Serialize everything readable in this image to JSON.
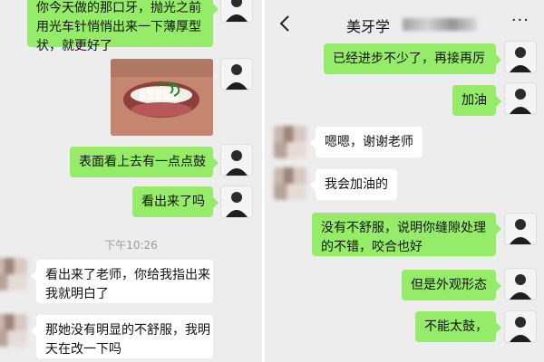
{
  "left": {
    "messages": [
      {
        "side": "me",
        "text_lines": [
          "你今天做的那口牙，抛光之前",
          "用光车针悄悄出来一下薄厚型",
          "状，就更好了"
        ]
      },
      {
        "side": "me",
        "type": "photo"
      },
      {
        "side": "me",
        "text_lines": [
          "表面看上去有一点点鼓"
        ]
      },
      {
        "side": "me",
        "text_lines": [
          "看出来了吗"
        ]
      },
      {
        "side": "other",
        "text_lines": [
          "看出来了老师，你给我指出来",
          "我就明白了"
        ]
      },
      {
        "side": "other",
        "text_lines": [
          "那她没有明显的不舒服，我明",
          "天在改一下吗"
        ]
      }
    ],
    "timestamp": "下午10:26"
  },
  "right": {
    "header": {
      "back_icon": "chevron-left-icon",
      "title": "美牙学",
      "more_icon": "more-dots-icon",
      "more_glyph": "···"
    },
    "messages": [
      {
        "side": "me",
        "text_lines": [
          "已经进步不少了，再接再厉"
        ]
      },
      {
        "side": "me",
        "text_lines": [
          "加油"
        ]
      },
      {
        "side": "other",
        "text_lines": [
          "嗯嗯，谢谢老师"
        ]
      },
      {
        "side": "other",
        "text_lines": [
          "我会加油的"
        ]
      },
      {
        "side": "me",
        "text_lines": [
          "没有不舒服，说明你缝隙处理",
          "的不错，咬合也好"
        ]
      },
      {
        "side": "me",
        "text_lines": [
          "但是外观形态"
        ]
      },
      {
        "side": "me",
        "text_lines": [
          "不能太鼓，"
        ]
      }
    ]
  },
  "colors": {
    "chat_bg": "#ededed",
    "bubble_me": "#95ec69",
    "bubble_other": "#ffffff",
    "timestamp": "#9b9b9b"
  }
}
